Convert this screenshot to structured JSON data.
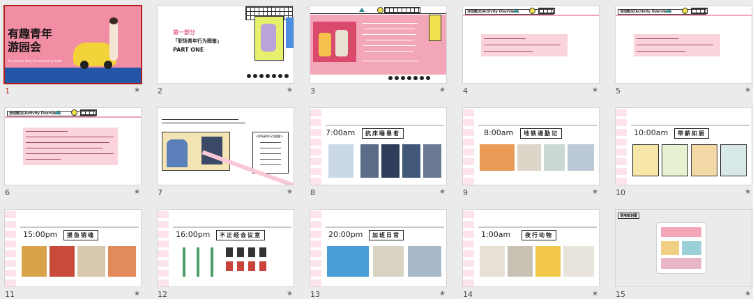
{
  "slides": [
    {
      "num": "1",
      "title": "有趣青年\n游园会",
      "subtitle": "The Garden Party For Interesting Youth"
    },
    {
      "num": "2",
      "title": "「职场青年行为图鉴」",
      "part": "PART ONE"
    },
    {
      "num": "3"
    },
    {
      "num": "4",
      "header": "活动概况(Activity Overview)"
    },
    {
      "num": "5",
      "header": "活动概况(Activity Overview)"
    },
    {
      "num": "6",
      "header": "活动概况(Activity Overview)"
    },
    {
      "num": "7",
      "panel": "<职场青年行为图鉴>"
    },
    {
      "num": "8",
      "time": "7:00am",
      "title": "抗床睡患者"
    },
    {
      "num": "9",
      "time": "8:00am",
      "title": "地铁通勤记"
    },
    {
      "num": "10",
      "time": "10:00am",
      "title": "带薪如厕"
    },
    {
      "num": "11",
      "time": "15:00pm",
      "title": "摸鱼销魂"
    },
    {
      "num": "12",
      "time": "16:00pm",
      "title": "不正经会议室"
    },
    {
      "num": "13",
      "time": "20:00pm",
      "title": "加班日常"
    },
    {
      "num": "14",
      "time": "1:00am",
      "title": "夜行动物"
    },
    {
      "num": "15",
      "header": "场地规划图"
    }
  ],
  "colors": {
    "pink": "#f3a6b8",
    "selected": "#b21d1d",
    "teal": "#2a8d95"
  },
  "star": "★"
}
